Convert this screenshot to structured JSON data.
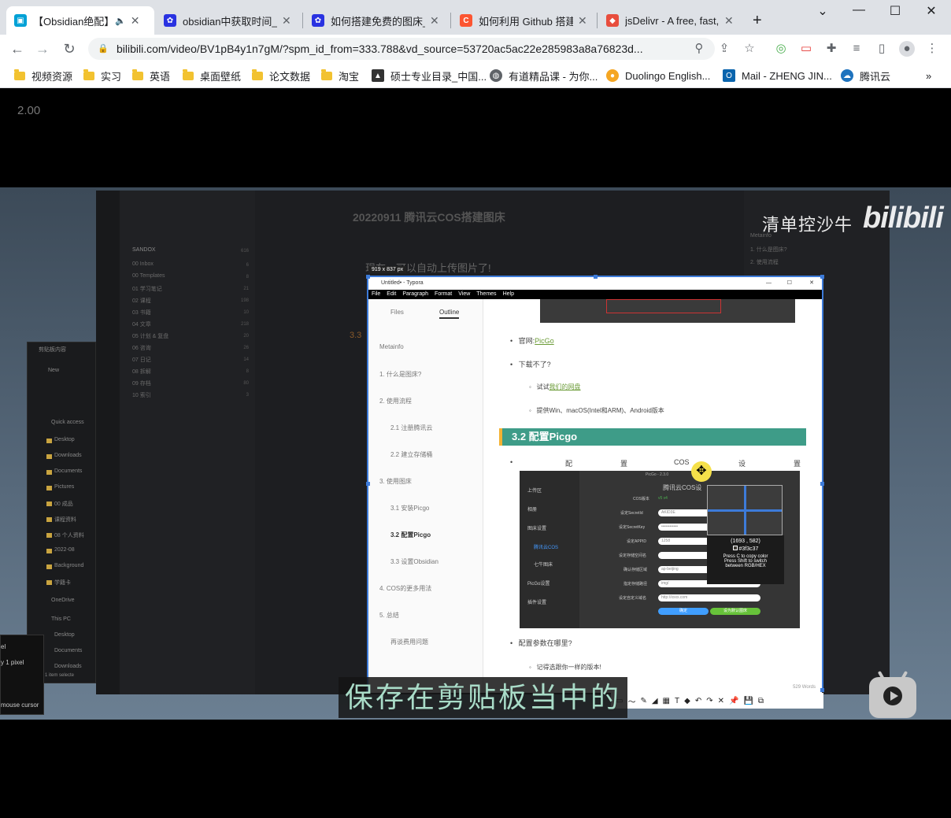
{
  "tabs": [
    {
      "title": "【Obsidian绝配】",
      "favicon": "bilibili-icon",
      "color": "#00a1d6",
      "active": true,
      "audio": true
    },
    {
      "title": "obsidian中获取时间_",
      "favicon": "baidu-icon",
      "color": "#2932e1"
    },
    {
      "title": "如何搭建免费的图床_",
      "favicon": "baidu-icon",
      "color": "#2932e1"
    },
    {
      "title": "如何利用 Github 搭建",
      "favicon": "csdn-icon",
      "color": "#fc5531"
    },
    {
      "title": "jsDelivr - A free, fast,",
      "favicon": "jsdelivr-icon",
      "color": "#e84d3d"
    }
  ],
  "new_tab_label": "+",
  "window_controls": {
    "chevron": "⌄",
    "minimize": "—",
    "maximize": "☐",
    "close": "✕"
  },
  "address_bar": {
    "url": "bilibili.com/video/BV1pB4y1n7gM/?spm_id_from=333.788&vd_source=53720ac5ac22e285983a8a76823d..."
  },
  "bookmarks": [
    {
      "label": "视频资源",
      "type": "folder"
    },
    {
      "label": "实习",
      "type": "folder"
    },
    {
      "label": "英语",
      "type": "folder"
    },
    {
      "label": "桌面壁纸",
      "type": "folder"
    },
    {
      "label": "论文数据",
      "type": "folder"
    },
    {
      "label": "淘宝",
      "type": "folder"
    },
    {
      "label": "硕士专业目录_中国...",
      "type": "link",
      "icon": "graduation-cap-icon",
      "color": "#333333"
    },
    {
      "label": "有道精品课 - 为你...",
      "type": "link",
      "icon": "globe-icon",
      "color": "#5f6368"
    },
    {
      "label": "Duolingo English...",
      "type": "link",
      "icon": "duolingo-icon",
      "color": "#f5a623"
    },
    {
      "label": "Mail - ZHENG JIN...",
      "type": "link",
      "icon": "outlook-icon",
      "color": "#0a64ad"
    },
    {
      "label": "腾讯云",
      "type": "link",
      "icon": "tencent-cloud-icon",
      "color": "#1e73be"
    }
  ],
  "bookmarks_more": "»",
  "video": {
    "speed": "2.00",
    "uploader_watermark": "清单控沙牛",
    "logo": "bilibili",
    "subtitle": "保存在剪贴板当中的"
  },
  "obsidian": {
    "doc_title": "20220911 腾讯云COS搭建图床",
    "vault_name": "SANDOX",
    "vault_count": "616",
    "files": [
      {
        "name": "00 Inbox",
        "count": "6"
      },
      {
        "name": "00 Templates",
        "count": "8"
      },
      {
        "name": "01 学习笔记",
        "count": "21"
      },
      {
        "name": "02 课程",
        "count": "198"
      },
      {
        "name": "03 书籍",
        "count": "10"
      },
      {
        "name": "04 文章",
        "count": "218"
      },
      {
        "name": "05 计划 & 复盘",
        "count": "20"
      },
      {
        "name": "06 咨询",
        "count": "26"
      },
      {
        "name": "07 日记",
        "count": "14"
      },
      {
        "name": "08 拆解",
        "count": "8"
      },
      {
        "name": "09 存档",
        "count": "80"
      },
      {
        "name": "10 索引",
        "count": "3"
      }
    ],
    "body_text": "现在，可以自动上传图片了!",
    "section_fragment": "3.3",
    "outline": [
      "Metainfo",
      "1. 什么是图床?",
      "2. 使用流程"
    ]
  },
  "explorer": {
    "title": "剪贴板内容",
    "new_label": "New",
    "items": [
      "Quick access",
      "Desktop",
      "Downloads",
      "Documents",
      "Pictures",
      "00 成品",
      "课程资料",
      "08 个人资料",
      "2022-08",
      "Background",
      "学籍卡",
      "OneDrive",
      "This PC",
      "Desktop",
      "Documents",
      "Downloads"
    ],
    "status": "1 item   1 item selecte"
  },
  "magnifier_tip": {
    "line1": "el",
    "line2": "y 1 pixel",
    "line3": "mouse cursor"
  },
  "snip": {
    "size_label": "919 x 837  px",
    "typora": {
      "title": "Untitled• - Typora",
      "menu": [
        "File",
        "Edit",
        "Paragraph",
        "Format",
        "View",
        "Themes",
        "Help"
      ],
      "tabs": [
        "Files",
        "Outline"
      ],
      "outline": [
        "Metainfo",
        "1. 什么是图床?",
        "2. 使用流程",
        "2.1 注册腾讯云",
        "2.2 建立存储桶",
        "3. 使用图床",
        "3.1 安装Picgo",
        "3.2 配置Picgo",
        "3.3 设置Obsidian",
        "4. COS的更多用法",
        "5. 总结",
        "再谈费用问题"
      ],
      "bullets": {
        "website_label": "官网:",
        "website_link": "PicGo",
        "download": "下载不了?",
        "try_label": "试试",
        "try_link": "我们的网盘",
        "platforms": "提供Win、macOS(Intel和ARM)、Android版本"
      },
      "heading": "3.2 配置Picgo",
      "config_words": [
        "配",
        "置",
        "COS",
        "设",
        "置"
      ],
      "question": "配置参数在哪里?",
      "answer": "记得选跟你一样的版本!",
      "word_count": "529 Words"
    },
    "picgo": {
      "title": "PicGo - 2.3.0",
      "header": "腾讯云COS设",
      "side_items": [
        "上传区",
        "相册",
        "图床设置",
        "腾讯云COS",
        "七牛图床",
        "PicGo设置",
        "插件设置"
      ],
      "labels": [
        "COS版本",
        "设定SecretId",
        "设定SecretKey",
        "设定APPID",
        "设定存储空间名",
        "确认存储区域",
        "指定存储路径",
        "设定自定义域名"
      ],
      "values": [
        "v5   v4",
        "AKID3E",
        "••••••••••••",
        "1258",
        "",
        "ap-beijing",
        "img/",
        "http://xxxx.com"
      ],
      "confirm": "确定",
      "default_btn": "设为默认图床",
      "coords": "(1693 , 582)",
      "hex": "#3f3c37",
      "tip1": "Press C to copy color",
      "tip2": "Press Shift to switch",
      "tip3": "between RGB/HEX"
    },
    "tools": [
      "▭",
      "〜",
      "✎",
      "◢",
      "▦",
      "T",
      "◆",
      "↶",
      "↷",
      "✕",
      "📌",
      "💾",
      "⧉"
    ]
  },
  "colors": {
    "accent": "#3d7bd9",
    "typora_heading": "#3e9c88",
    "subtitle": "#a9dcc8"
  }
}
